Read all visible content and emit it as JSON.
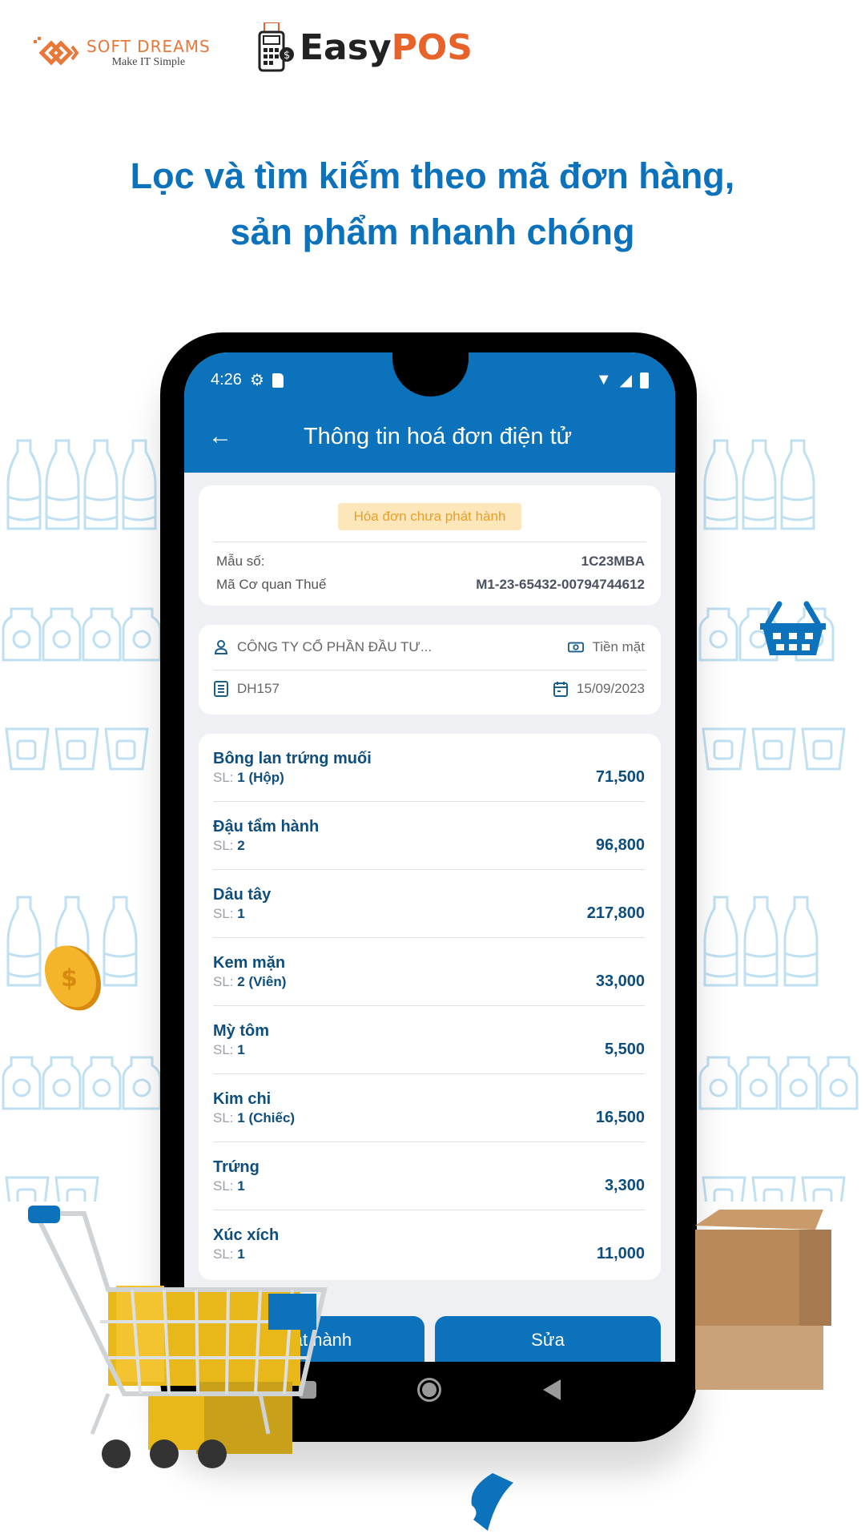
{
  "branding": {
    "softdreams_name": "SOFT DREAMS",
    "softdreams_tagline": "Make IT Simple",
    "easypos_easy": "Easy",
    "easypos_pos": "POS"
  },
  "headline": {
    "line1": "Lọc và tìm kiếm theo mã đơn hàng,",
    "line2": "sản phẩm nhanh chóng"
  },
  "status_bar": {
    "time": "4:26",
    "icons_left": [
      "gear-icon",
      "sd-card-icon"
    ],
    "icons_right": [
      "wifi-icon",
      "signal-icon",
      "battery-icon"
    ]
  },
  "app_bar": {
    "title": "Thông tin hoá đơn điện tử",
    "back_icon": "arrow-left-icon"
  },
  "invoice_card": {
    "status_badge": "Hóa đơn chưa phát hành",
    "template_label": "Mẫu số:",
    "template_value": "1C23MBA",
    "tax_code_label": "Mã Cơ quan Thuế",
    "tax_code_value": "M1-23-65432-00794744612"
  },
  "order_card": {
    "customer": "CÔNG TY CỔ PHẦN ĐẦU TƯ...",
    "payment_method": "Tiền mặt",
    "order_code": "DH157",
    "date": "15/09/2023"
  },
  "items": [
    {
      "name": "Bông lan trứng muối",
      "qty_label": "SL:",
      "qty": "1 (Hộp)",
      "price": "71,500"
    },
    {
      "name": "Đậu tẩm hành",
      "qty_label": "SL:",
      "qty": "2",
      "price": "96,800"
    },
    {
      "name": "Dâu tây",
      "qty_label": "SL:",
      "qty": "1",
      "price": "217,800"
    },
    {
      "name": "Kem mặn",
      "qty_label": "SL:",
      "qty": "2 (Viên)",
      "price": "33,000"
    },
    {
      "name": "Mỳ tôm",
      "qty_label": "SL:",
      "qty": "1",
      "price": "5,500"
    },
    {
      "name": "Kim chi",
      "qty_label": "SL:",
      "qty": "1 (Chiếc)",
      "price": "16,500"
    },
    {
      "name": "Trứng",
      "qty_label": "SL:",
      "qty": "1",
      "price": "3,300"
    },
    {
      "name": "Xúc xích",
      "qty_label": "SL:",
      "qty": "1",
      "price": "11,000"
    }
  ],
  "actions": {
    "issue_label": "Phát hành",
    "edit_label": "Sửa"
  },
  "colors": {
    "primary": "#0b72bb",
    "badge_bg": "#fde6b9",
    "badge_text": "#e8a02b",
    "item_text": "#0d4e7e",
    "brand_orange": "#e8632a"
  }
}
